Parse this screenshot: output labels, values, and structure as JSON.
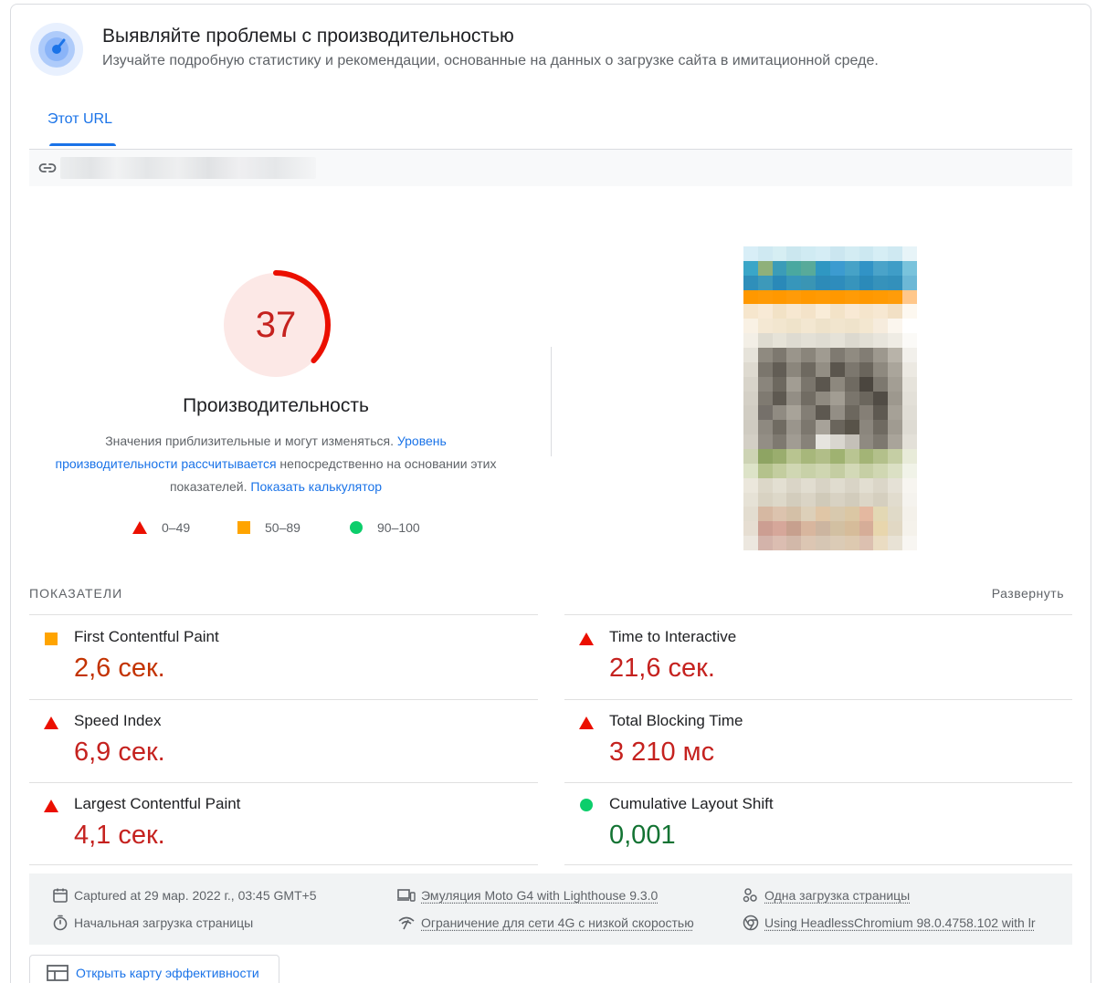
{
  "header": {
    "title": "Выявляйте проблемы с производительностью",
    "subtitle": "Изучайте подробную статистику и рекомендации, основанные на данных о загрузке сайта в имитационной среде."
  },
  "tabs": [
    {
      "label": "Этот URL",
      "active": true
    }
  ],
  "url_bar": {
    "icon": "link-icon"
  },
  "performance": {
    "score": "37",
    "score_fraction": 0.37,
    "title": "Производительность",
    "desc_plain_1": "Значения приблизительные и могут изменяться. ",
    "desc_link_1": "Уровень производительности рассчитывается",
    "desc_plain_2": " непосредственно на основании этих показателей. ",
    "desc_link_2": "Показать калькулятор",
    "legend": [
      {
        "shape": "triangle",
        "color": "#eb0f00",
        "label": "0–49"
      },
      {
        "shape": "square",
        "color": "#ffa400",
        "label": "50–89"
      },
      {
        "shape": "circle",
        "color": "#0cce6b",
        "label": "90–100"
      }
    ]
  },
  "metrics": {
    "section_label": "ПОКАЗАТЕЛИ",
    "expand_label": "Развернуть",
    "items": [
      {
        "name": "First Contentful Paint",
        "value": "2,6 сек.",
        "status": "average"
      },
      {
        "name": "Time to Interactive",
        "value": "21,6 сек.",
        "status": "fail"
      },
      {
        "name": "Speed Index",
        "value": "6,9 сек.",
        "status": "fail"
      },
      {
        "name": "Total Blocking Time",
        "value": "3 210 мс",
        "status": "fail"
      },
      {
        "name": "Largest Contentful Paint",
        "value": "4,1 сек.",
        "status": "fail"
      },
      {
        "name": "Cumulative Layout Shift",
        "value": "0,001",
        "status": "pass"
      }
    ]
  },
  "info": {
    "captured": "Captured at 29 мар. 2022 г., 03:45 GMT+5",
    "initial_load": "Начальная загрузка страницы",
    "emulation": "Эмуляция Moto G4 with Lighthouse 9.3.0",
    "throttling": "Ограничение для сети 4G с низкой скоростью",
    "single_load": "Одна загрузка страницы",
    "browser": "Using HeadlessChromium 98.0.4758.102 with lr"
  },
  "treemap_button": {
    "label": "Открыть карту эффективности"
  },
  "colors": {
    "fail": "#c5221f",
    "average": "#c33300",
    "pass": "#137333",
    "accent": "#1a73e8"
  }
}
